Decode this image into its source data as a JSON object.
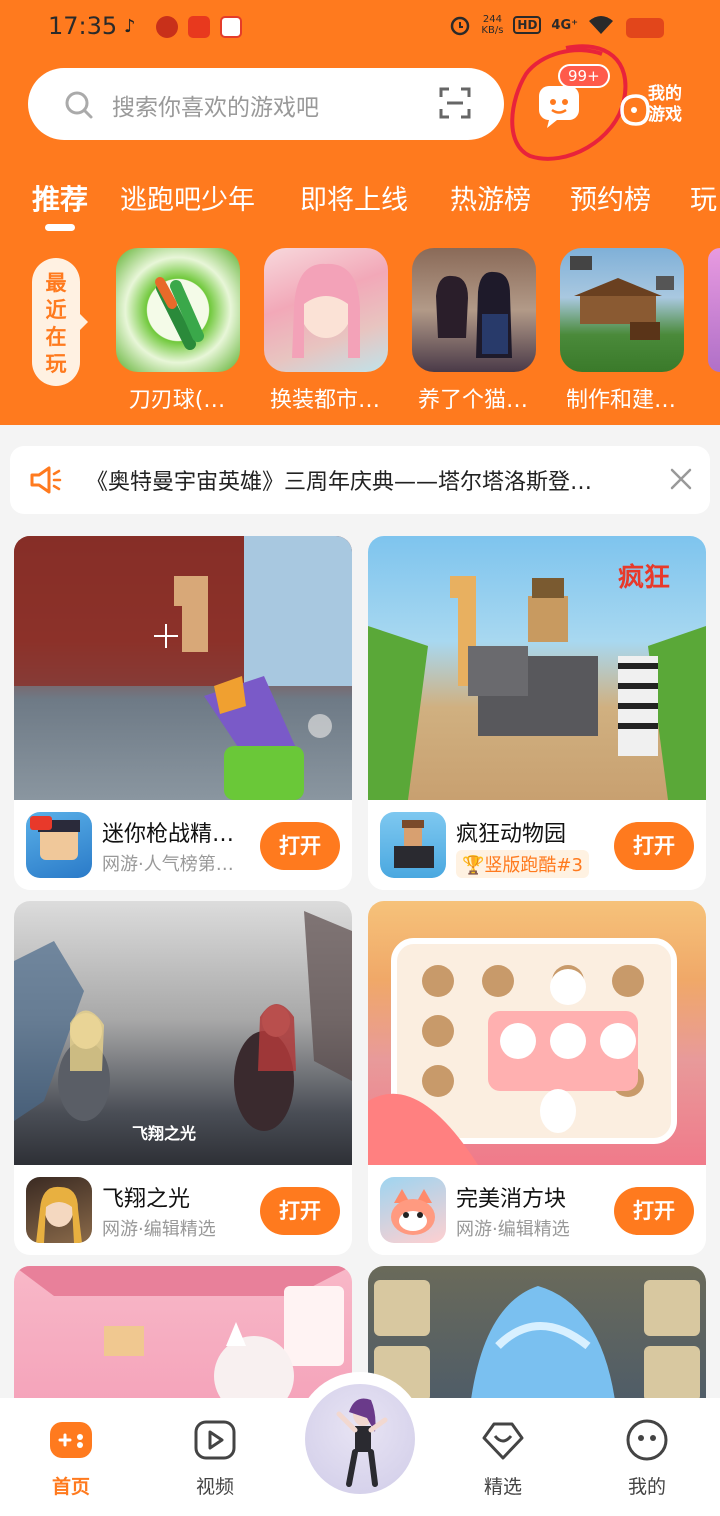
{
  "status_bar": {
    "time": "17:35",
    "net_speed_value": "244",
    "net_speed_unit": "KB/s",
    "hd": "HD",
    "signal": "4G⁺"
  },
  "search": {
    "placeholder": "搜索你喜欢的游戏吧"
  },
  "messages": {
    "badge": "99+"
  },
  "my_games": {
    "label": "我的游戏"
  },
  "tabs": [
    "推荐",
    "逃跑吧少年",
    "即将上线",
    "热游榜",
    "预约榜",
    "玩"
  ],
  "recent": {
    "label": "最近在玩",
    "games": [
      {
        "name": "刀刃球(…"
      },
      {
        "name": "换装都市…"
      },
      {
        "name": "养了个猫…"
      },
      {
        "name": "制作和建…"
      }
    ]
  },
  "notice": {
    "text": "《奥特曼宇宙英雄》三周年庆典——塔尔塔洛斯登…"
  },
  "cards": [
    {
      "title": "迷你枪战精…",
      "subtitle": "网游·人气榜第…",
      "button": "打开"
    },
    {
      "title": "疯狂动物园",
      "subtitle": "竖版跑酷#3",
      "button": "打开"
    },
    {
      "title": "飞翔之光",
      "subtitle": "网游·编辑精选",
      "button": "打开"
    },
    {
      "title": "完美消方块",
      "subtitle": "网游·编辑精选",
      "button": "打开"
    }
  ],
  "bottom_nav": [
    {
      "label": "首页"
    },
    {
      "label": "视频"
    },
    {
      "label": "精选"
    },
    {
      "label": "我的"
    }
  ],
  "colors": {
    "accent": "#ff7a1e",
    "badge_red": "#ff5a4a"
  }
}
